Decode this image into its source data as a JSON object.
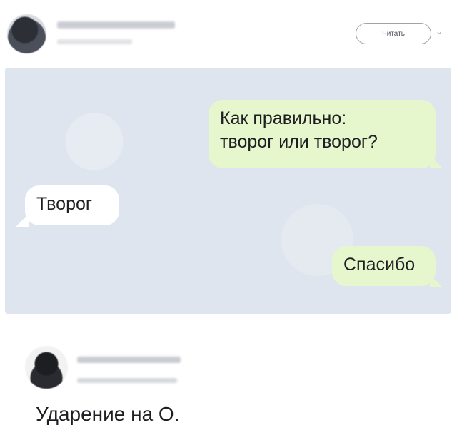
{
  "header": {
    "follow_button_label": "Читать",
    "chevron_icon": "chevron-down-icon"
  },
  "chat": {
    "messages": [
      {
        "direction": "outgoing",
        "lines": [
          "Как правильно:",
          "творог или творог?"
        ]
      },
      {
        "direction": "incoming",
        "lines": [
          "Творог"
        ]
      },
      {
        "direction": "outgoing",
        "lines": [
          "Спасибо"
        ]
      }
    ]
  },
  "reply": {
    "text": "Ударение на О."
  },
  "colors": {
    "chat_background": "#dfe5ee",
    "outgoing_bubble": "#e6f7cd",
    "incoming_bubble": "#ffffff"
  }
}
